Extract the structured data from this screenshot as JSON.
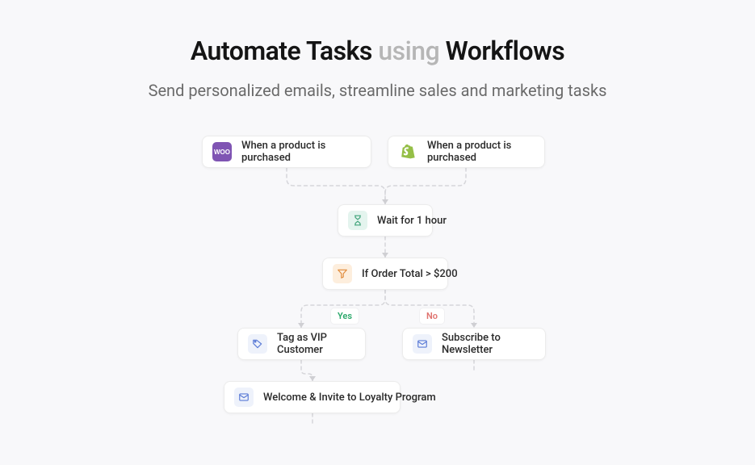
{
  "heading": {
    "title_pre": "Automate Tasks ",
    "title_mid": "using ",
    "title_post": "Workflows",
    "subtitle": "Send personalized emails, streamline sales and marketing tasks"
  },
  "nodes": {
    "trigger_woo": {
      "label": "When a product is purchased",
      "icon": "woocommerce-icon"
    },
    "trigger_shopify": {
      "label": "When a product is purchased",
      "icon": "shopify-icon"
    },
    "wait": {
      "label": "Wait for 1 hour",
      "icon": "hourglass-icon"
    },
    "filter": {
      "label": "If Order Total > $200",
      "icon": "filter-icon"
    },
    "branch_yes": {
      "label": "Yes"
    },
    "branch_no": {
      "label": "No"
    },
    "tag_vip": {
      "label": "Tag as VIP Customer",
      "icon": "tag-icon"
    },
    "subscribe": {
      "label": "Subscribe to Newsletter",
      "icon": "mail-icon"
    },
    "welcome": {
      "label": "Welcome & Invite to Loyalty Program",
      "icon": "mail-icon"
    }
  },
  "colors": {
    "connector": "#d8d8db",
    "yes": "#2aa86a",
    "no": "#e0736f"
  }
}
